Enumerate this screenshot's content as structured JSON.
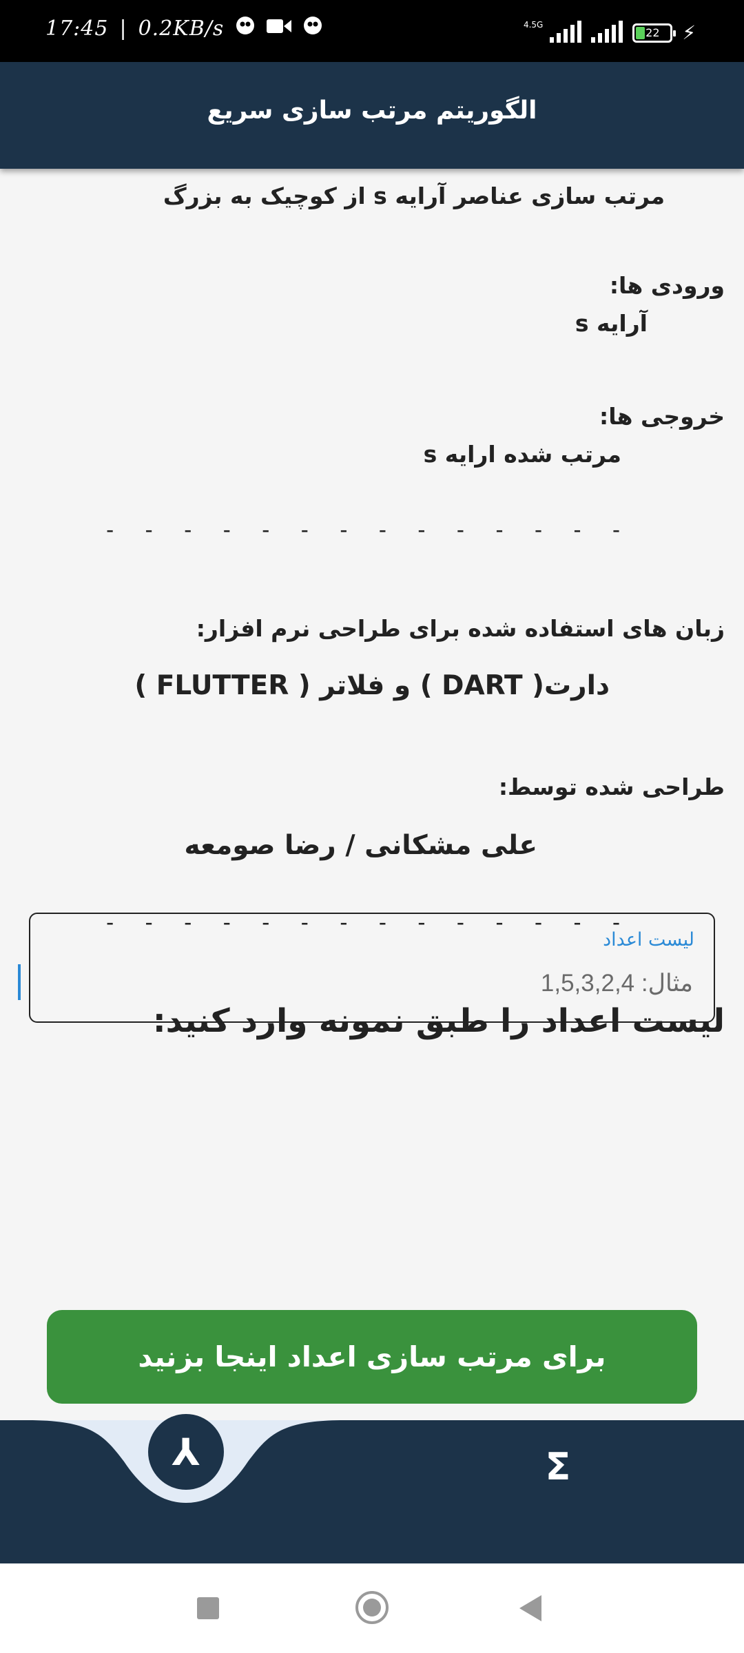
{
  "status_bar": {
    "time": "17:45",
    "separator": "|",
    "speed": "0.2KB/s",
    "network_type": "4.5G",
    "battery": "22",
    "icons": [
      "chat-bubble-icon",
      "video-camera-icon",
      "chat-bubble-icon",
      "signal-icon",
      "signal-icon",
      "battery-icon",
      "charging-bolt-icon"
    ]
  },
  "app_bar": {
    "title": "الگوریتم مرتب سازی سریع"
  },
  "description": "مرتب سازی عناصر آرایه s از کوچیک به بزرگ",
  "inputs": {
    "heading": "ورودی ها:",
    "value": "آرایه s"
  },
  "outputs": {
    "heading": "خروجی ها:",
    "value": "مرتب شده ارایه s"
  },
  "divider": "- - - - - - - - - - - - - - - - - - - - - - - - - - - - - - -",
  "languages": {
    "heading": "زبان های استفاده شده برای طراحی نرم افزار:",
    "value": "دارت( DART ) و فلاتر ( FLUTTER )"
  },
  "designers": {
    "heading": "طراحی شده توسط:",
    "value": "علی مشکانی / رضا صومعه"
  },
  "prompt": "لیست اعداد را طبق نمونه وارد کنید:",
  "number_field": {
    "label": "لیست اعداد",
    "placeholder": "مثال: 1,5,3,2,4",
    "value": ""
  },
  "sort_button": {
    "label": "برای مرتب سازی اعداد اینجا بزنید"
  },
  "bottom_nav": {
    "items": [
      {
        "icon": "merge-icon",
        "glyph": "⅄",
        "selected": true
      },
      {
        "icon": "sigma-icon",
        "glyph": "Σ",
        "selected": false
      }
    ]
  },
  "colors": {
    "app_bar": "#1c3349",
    "button": "#3a923d",
    "accent": "#2b8ad6",
    "background": "#f5f5f5",
    "nav_notch": "#e2ebf6"
  }
}
